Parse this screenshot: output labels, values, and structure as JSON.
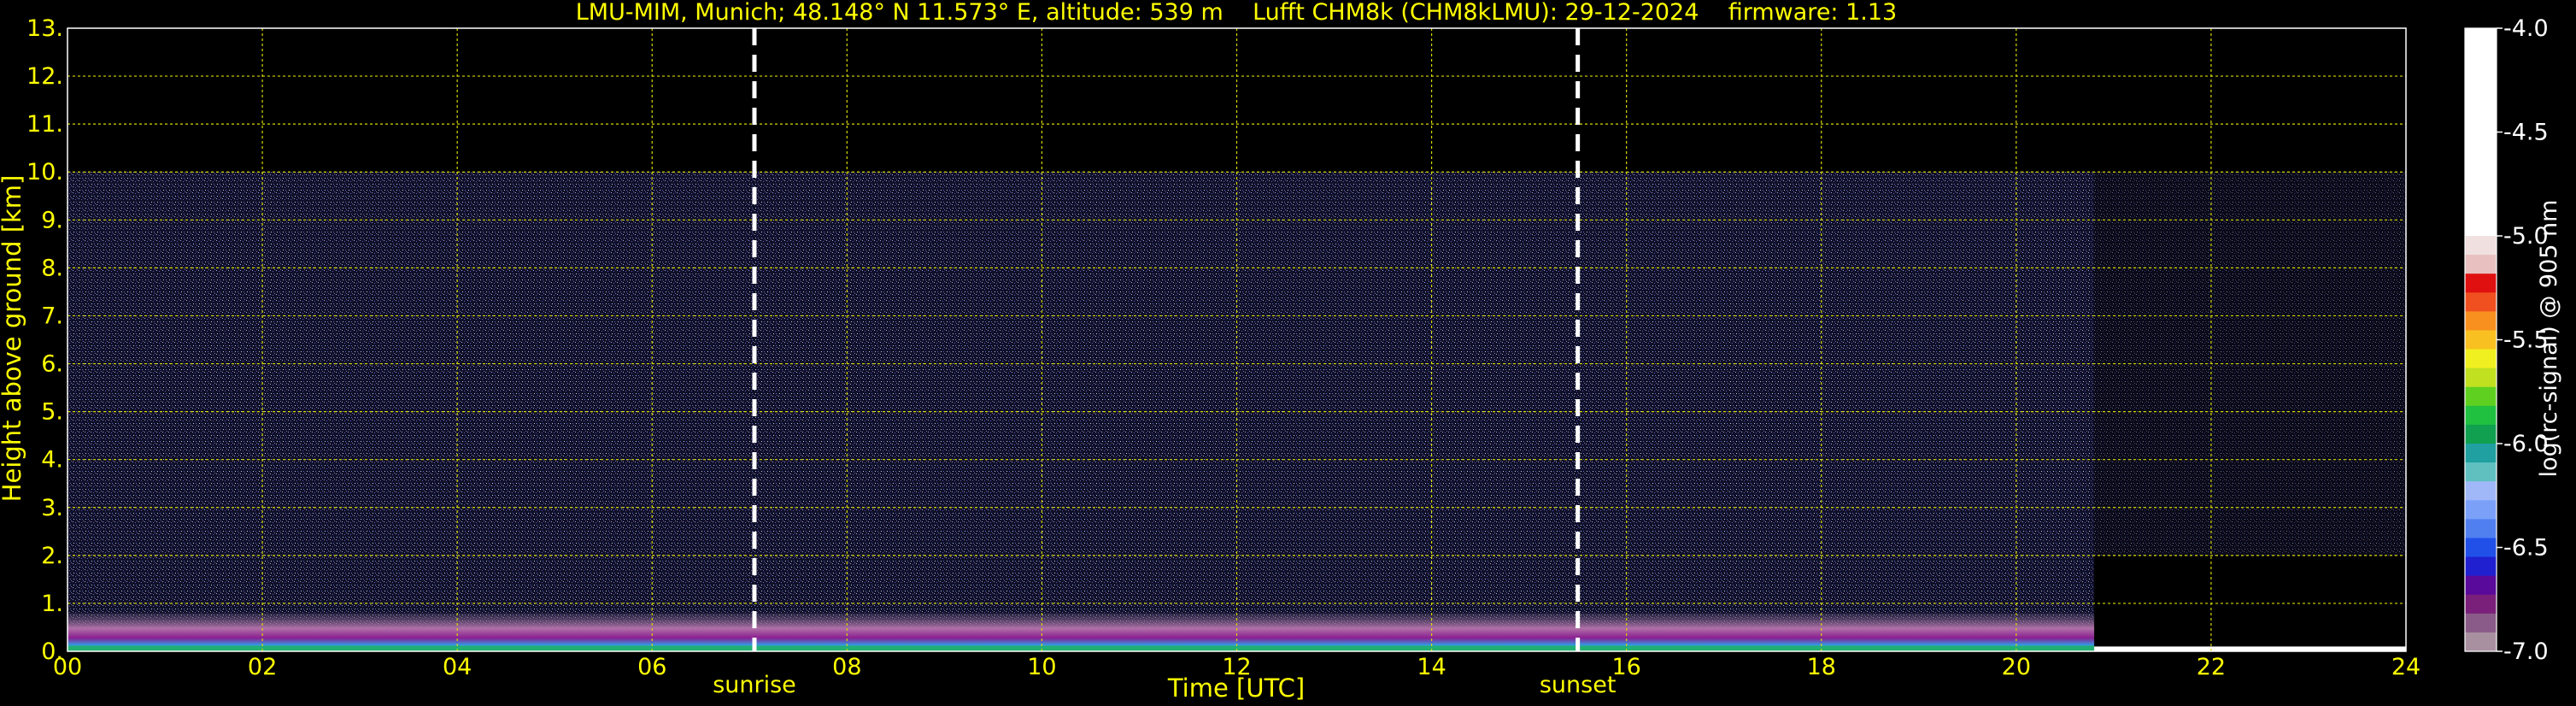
{
  "chart_data": {
    "type": "heatmap",
    "title": "LMU-MIM, Munich; 48.148° N 11.573° E, altitude: 539 m    Lufft CHM8k (CHM8kLMU): 29-12-2024    firmware: 1.13",
    "xlabel": "Time [UTC]",
    "ylabel": "Height above ground [km]",
    "xlim": [
      0,
      24
    ],
    "ylim": [
      0,
      13
    ],
    "x_ticks": [
      "00",
      "02",
      "04",
      "06",
      "08",
      "10",
      "12",
      "14",
      "16",
      "18",
      "20",
      "22",
      "24"
    ],
    "y_ticks": [
      "0.",
      "1.",
      "2.",
      "3.",
      "4.",
      "5.",
      "6.",
      "7.",
      "8.",
      "9.",
      "10.",
      "11.",
      "12.",
      "13."
    ],
    "grid": true,
    "annotations": [
      {
        "label": "sunrise",
        "x": 7.05
      },
      {
        "label": "sunset",
        "x": 15.5
      }
    ],
    "measurement": {
      "data_top_km": 10,
      "data_end_hour": 20.8
    },
    "colorbar": {
      "label": "log(rc-signal) @ 905 nm",
      "ticks": [
        "-4.0",
        "-4.5",
        "-5.0",
        "-5.5",
        "-6.0",
        "-6.5",
        "-7.0"
      ],
      "range": [
        -7.0,
        -4.0
      ],
      "colors": [
        "#a890a0",
        "#8a5a88",
        "#7a1f7a",
        "#5a0a9a",
        "#2020d0",
        "#2050e8",
        "#5080f0",
        "#7aa0f8",
        "#a0b8f8",
        "#60c0c0",
        "#20a0a0",
        "#10a050",
        "#20c040",
        "#60d020",
        "#c0e020",
        "#f0f020",
        "#f8c020",
        "#f89020",
        "#f05020",
        "#e01010",
        "#e8c0c0",
        "#f0e0e0",
        "#ffffff"
      ]
    }
  }
}
